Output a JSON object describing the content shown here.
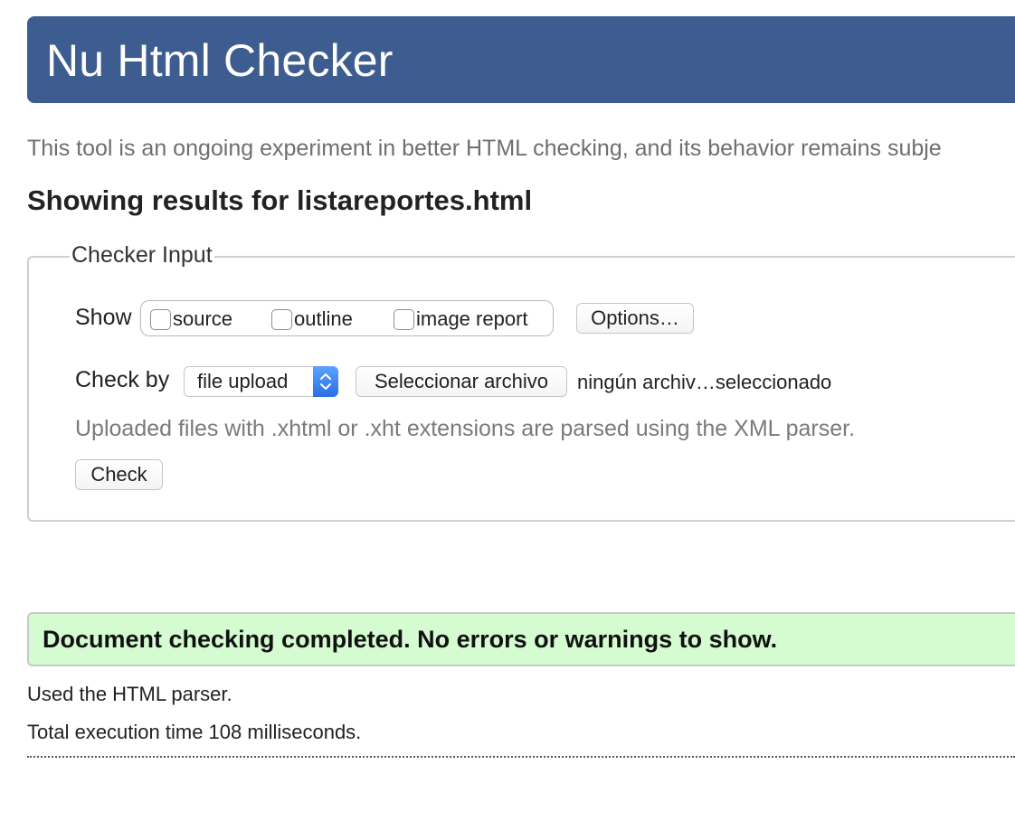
{
  "header": {
    "title": "Nu Html Checker"
  },
  "intro": "This tool is an ongoing experiment in better HTML checking, and its behavior remains subje",
  "results_title": "Showing results for listareportes.html",
  "checker_input": {
    "legend": "Checker Input",
    "show_label": "Show",
    "show_options": [
      {
        "label": "source",
        "checked": false
      },
      {
        "label": "outline",
        "checked": false
      },
      {
        "label": "image report",
        "checked": false
      }
    ],
    "options_button": "Options…",
    "check_by_label": "Check by",
    "check_by_value": "file upload",
    "file_button": "Seleccionar archivo",
    "file_status": "ningún archiv…seleccionado",
    "hint": "Uploaded files with .xhtml or .xht extensions are parsed using the XML parser.",
    "check_button": "Check"
  },
  "result": {
    "message": "Document checking completed. No errors or warnings to show.",
    "parser": "Used the HTML parser.",
    "execution_time": "Total execution time 108 milliseconds."
  },
  "colors": {
    "header_bg": "#3d5d91",
    "success_bg": "#d5fcd0",
    "select_accent": "#2a6fe6"
  }
}
